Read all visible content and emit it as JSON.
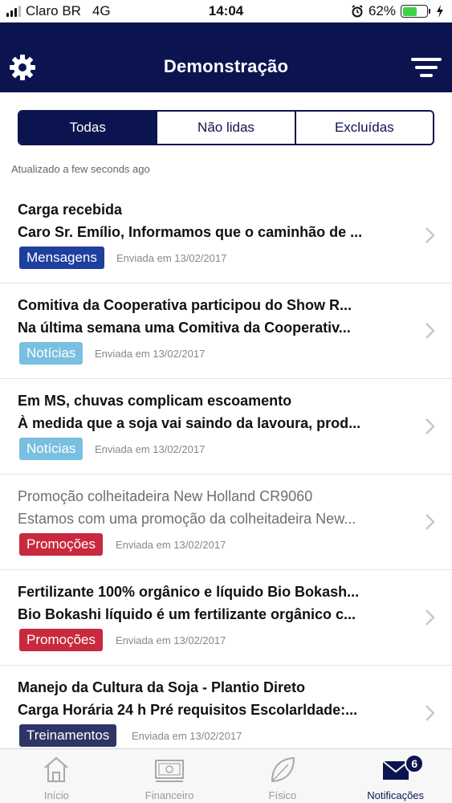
{
  "status_bar": {
    "carrier": "Claro BR",
    "network": "4G",
    "time": "14:04",
    "battery_percent": "62%",
    "battery_level": 0.62
  },
  "header": {
    "title": "Demonstração",
    "left_icon": "gear-icon",
    "right_icon": "filter-icon",
    "background_color": "#0c1450"
  },
  "segments": [
    {
      "label": "Todas",
      "active": true
    },
    {
      "label": "Não lidas",
      "active": false
    },
    {
      "label": "Excluídas",
      "active": false
    }
  ],
  "updated_text": "Atualizado a few seconds ago",
  "notifications": [
    {
      "title": "Carga recebida",
      "body": "Caro Sr. Emílio, Informamos que o caminhão de ...",
      "tag": "Mensagens",
      "tag_color": "#1f3f9e",
      "date": "Enviada em 13/02/2017",
      "read": false
    },
    {
      "title": "Comitiva da Cooperativa participou do Show R...",
      "body": "Na última semana uma Comitiva da Cooperativ...",
      "tag": "Notícias",
      "tag_color": "#79bfe0",
      "date": "Enviada em 13/02/2017",
      "read": false
    },
    {
      "title": "Em MS, chuvas complicam escoamento",
      "body": "À medida que a soja vai saindo da lavoura, prod...",
      "tag": "Notícias",
      "tag_color": "#79bfe0",
      "date": "Enviada em 13/02/2017",
      "read": false
    },
    {
      "title": "Promoção colheitadeira New Holland CR9060",
      "body": "Estamos com uma promoção da colheitadeira New...",
      "tag": "Promoções",
      "tag_color": "#c8293e",
      "date": "Enviada em 13/02/2017",
      "read": true
    },
    {
      "title": "Fertilizante 100% orgânico e líquido Bio Bokash...",
      "body": "Bio Bokashi líquido é um fertilizante orgânico c...",
      "tag": "Promoções",
      "tag_color": "#c8293e",
      "date": "Enviada em 13/02/2017",
      "read": false
    },
    {
      "title": "Manejo da Cultura da Soja - Plantio Direto",
      "body": "Carga Horária 24 h Pré requisitos Escolarldade:...",
      "tag": "Treinamentos",
      "tag_color": "#2e3566",
      "date": "Enviada em 13/02/2017",
      "read": false
    }
  ],
  "tabbar": {
    "items": [
      {
        "label": "Início",
        "icon": "house-icon",
        "active": false
      },
      {
        "label": "Financeiro",
        "icon": "banknote-icon",
        "active": false
      },
      {
        "label": "Físico",
        "icon": "leaf-icon",
        "active": false
      },
      {
        "label": "Notificações",
        "icon": "envelope-icon",
        "active": true,
        "badge": "6"
      }
    ]
  }
}
